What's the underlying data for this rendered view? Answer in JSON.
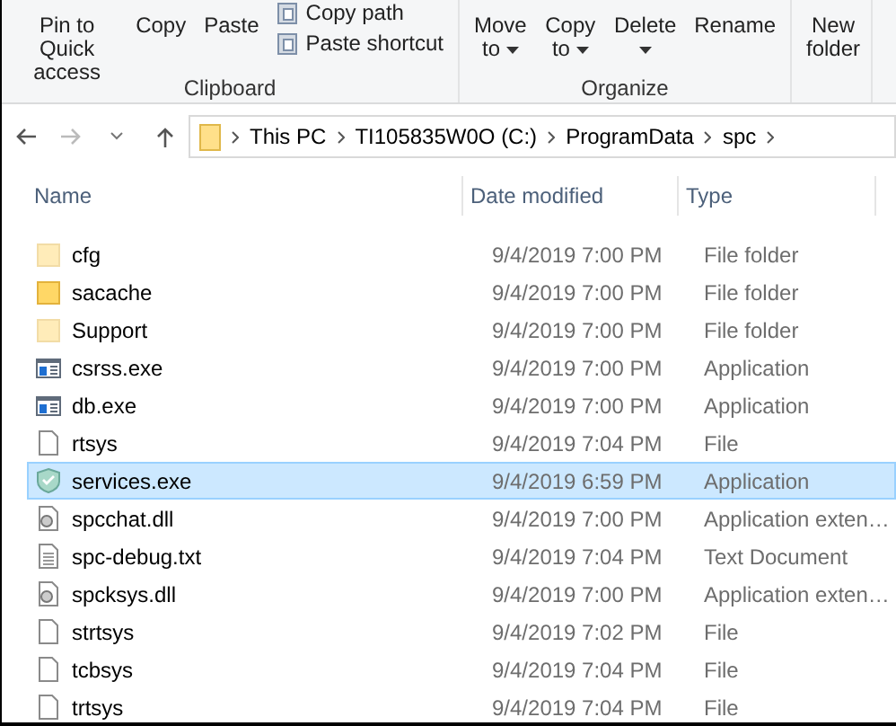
{
  "ribbon": {
    "groups": [
      {
        "label": "Clipboard",
        "buttons": [
          {
            "kind": "large",
            "label": "Pin to Quick access"
          },
          {
            "kind": "large",
            "label": "Copy"
          },
          {
            "kind": "large",
            "label": "Paste"
          },
          {
            "kind": "stack",
            "items": [
              "Copy path",
              "Paste shortcut"
            ]
          }
        ]
      },
      {
        "label": "Organize",
        "buttons": [
          {
            "kind": "menu",
            "label": "Move to"
          },
          {
            "kind": "menu",
            "label": "Copy to"
          },
          {
            "kind": "menu",
            "label": "Delete"
          },
          {
            "kind": "large",
            "label": "Rename"
          }
        ]
      },
      {
        "buttons": [
          {
            "kind": "large",
            "label": "New folder"
          }
        ]
      }
    ]
  },
  "address": {
    "path": [
      "This PC",
      "TI105835W0O (C:)",
      "ProgramData",
      "spc"
    ]
  },
  "table": {
    "columns": [
      "Name",
      "Date modified",
      "Type"
    ],
    "rows": [
      {
        "kind": "folder",
        "hidden": true,
        "selected": false,
        "name": "cfg",
        "date": "9/4/2019 7:00 PM",
        "type": "File folder"
      },
      {
        "kind": "folder",
        "hidden": false,
        "selected": false,
        "name": "sacache",
        "date": "9/4/2019 7:00 PM",
        "type": "File folder"
      },
      {
        "kind": "folder",
        "hidden": true,
        "selected": false,
        "name": "Support",
        "date": "9/4/2019 7:00 PM",
        "type": "File folder"
      },
      {
        "kind": "exe",
        "hidden": false,
        "selected": false,
        "name": "csrss.exe",
        "date": "9/4/2019 7:00 PM",
        "type": "Application"
      },
      {
        "kind": "exe",
        "hidden": false,
        "selected": false,
        "name": "db.exe",
        "date": "9/4/2019 7:00 PM",
        "type": "Application"
      },
      {
        "kind": "file",
        "hidden": false,
        "selected": false,
        "name": "rtsys",
        "date": "9/4/2019 7:04 PM",
        "type": "File"
      },
      {
        "kind": "shield",
        "hidden": false,
        "selected": true,
        "name": "services.exe",
        "date": "9/4/2019 6:59 PM",
        "type": "Application"
      },
      {
        "kind": "dll",
        "hidden": false,
        "selected": false,
        "name": "spcchat.dll",
        "date": "9/4/2019 7:00 PM",
        "type": "Application exten…"
      },
      {
        "kind": "text",
        "hidden": false,
        "selected": false,
        "name": "spc-debug.txt",
        "date": "9/4/2019 7:04 PM",
        "type": "Text Document"
      },
      {
        "kind": "dll",
        "hidden": false,
        "selected": false,
        "name": "spcksys.dll",
        "date": "9/4/2019 7:00 PM",
        "type": "Application exten…"
      },
      {
        "kind": "file",
        "hidden": false,
        "selected": false,
        "name": "strtsys",
        "date": "9/4/2019 7:02 PM",
        "type": "File"
      },
      {
        "kind": "file",
        "hidden": false,
        "selected": false,
        "name": "tcbsys",
        "date": "9/4/2019 7:04 PM",
        "type": "File"
      },
      {
        "kind": "file",
        "hidden": false,
        "selected": false,
        "name": "trtsys",
        "date": "9/4/2019 7:04 PM",
        "type": "File"
      }
    ]
  }
}
